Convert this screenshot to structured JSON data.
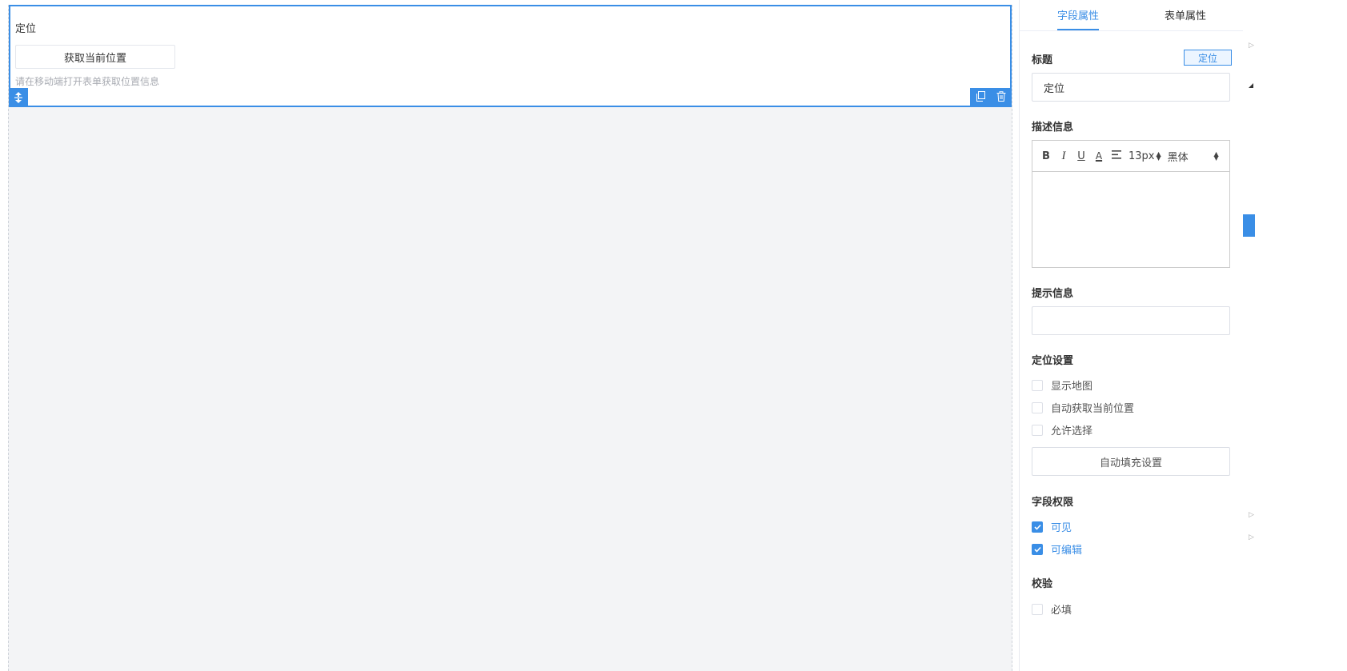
{
  "canvas": {
    "field": {
      "title": "定位",
      "locate_button": "获取当前位置",
      "hint": "请在移动端打开表单获取位置信息"
    }
  },
  "panel": {
    "tabs": [
      {
        "label": "字段属性",
        "active": true
      },
      {
        "label": "表单属性",
        "active": false
      }
    ],
    "title_section": {
      "label": "标题",
      "tag": "定位",
      "value": "定位"
    },
    "description_section": {
      "label": "描述信息",
      "toolbar": {
        "bold": "B",
        "italic": "I",
        "underline": "U",
        "color": "A",
        "font_size": "13px",
        "font_family": "黑体"
      }
    },
    "tip_section": {
      "label": "提示信息",
      "value": ""
    },
    "location_settings": {
      "label": "定位设置",
      "options": [
        {
          "label": "显示地图",
          "checked": false
        },
        {
          "label": "自动获取当前位置",
          "checked": false
        },
        {
          "label": "允许选择",
          "checked": false
        }
      ],
      "autofill_button": "自动填充设置"
    },
    "permissions": {
      "label": "字段权限",
      "options": [
        {
          "label": "可见",
          "checked": true
        },
        {
          "label": "可编辑",
          "checked": true
        }
      ]
    },
    "validation": {
      "label": "校验",
      "options": [
        {
          "label": "必填",
          "checked": false
        }
      ]
    }
  },
  "colors": {
    "accent": "#3a8ee6",
    "canvas_bg": "#f3f4f6"
  }
}
